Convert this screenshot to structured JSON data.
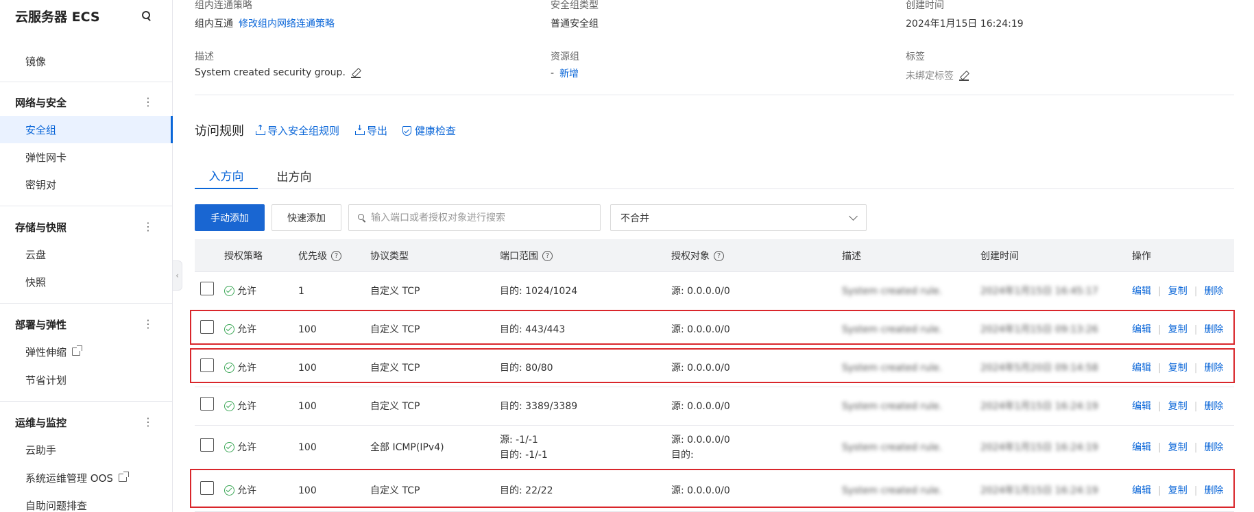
{
  "sidebar": {
    "title": "云服务器 ECS",
    "items_top": [
      "镜像"
    ],
    "groups": [
      {
        "title": "网络与安全",
        "items": [
          "安全组",
          "弹性网卡",
          "密钥对"
        ]
      },
      {
        "title": "存储与快照",
        "items": [
          "云盘",
          "快照"
        ]
      },
      {
        "title": "部署与弹性",
        "items": [
          "弹性伸缩",
          "节省计划"
        ]
      },
      {
        "title": "运维与监控",
        "items": [
          "云助手",
          "系统运维管理 OOS",
          "自助问题排查"
        ]
      }
    ],
    "collapse_glyph": "‹"
  },
  "info": {
    "intra_label": "组内连通策略",
    "intra_value": "组内互通",
    "intra_link": "修改组内网络连通策略",
    "type_label": "安全组类型",
    "type_value": "普通安全组",
    "created_label": "创建时间",
    "created_value": "2024年1月15日 16:24:19",
    "desc_label": "描述",
    "desc_value": "System created security group.",
    "rg_label": "资源组",
    "rg_dash": "-",
    "rg_link": "新增",
    "tags_label": "标签",
    "tags_value": "未绑定标签"
  },
  "rules": {
    "title": "访问规则",
    "import": "导入安全组规则",
    "export": "导出",
    "health": "健康检查"
  },
  "tabs": [
    "入方向",
    "出方向"
  ],
  "toolbar": {
    "manual_add": "手动添加",
    "quick_add": "快速添加",
    "search_placeholder": "输入端口或者授权对象进行搜索",
    "merge_select": "不合并"
  },
  "table": {
    "headers": [
      "授权策略",
      "优先级",
      "协议类型",
      "端口范围",
      "授权对象",
      "描述",
      "创建时间",
      "操作"
    ],
    "rows": [
      {
        "policy": "允许",
        "priority": "1",
        "protocol": "自定义 TCP",
        "port": [
          "目的: 1024/1024"
        ],
        "target": [
          "源: 0.0.0.0/0"
        ],
        "desc": "System created rule.",
        "created": "2024年1月15日 16:45:17",
        "highlight": false
      },
      {
        "policy": "允许",
        "priority": "100",
        "protocol": "自定义 TCP",
        "port": [
          "目的: 443/443"
        ],
        "target": [
          "源: 0.0.0.0/0"
        ],
        "desc": "System created rule.",
        "created": "2024年1月15日 09:13:26",
        "highlight": true
      },
      {
        "policy": "允许",
        "priority": "100",
        "protocol": "自定义 TCP",
        "port": [
          "目的: 80/80"
        ],
        "target": [
          "源: 0.0.0.0/0"
        ],
        "desc": "System created rule.",
        "created": "2024年5月20日 09:14:58",
        "highlight": true
      },
      {
        "policy": "允许",
        "priority": "100",
        "protocol": "自定义 TCP",
        "port": [
          "目的: 3389/3389"
        ],
        "target": [
          "源: 0.0.0.0/0"
        ],
        "desc": "System created rule.",
        "created": "2024年1月15日 16:24:19",
        "highlight": false
      },
      {
        "policy": "允许",
        "priority": "100",
        "protocol": "全部 ICMP(IPv4)",
        "port": [
          "源: -1/-1",
          "目的: -1/-1"
        ],
        "target": [
          "源: 0.0.0.0/0",
          "目的:"
        ],
        "desc": "System created rule.",
        "created": "2024年1月15日 16:24:19",
        "highlight": false
      },
      {
        "policy": "允许",
        "priority": "100",
        "protocol": "自定义 TCP",
        "port": [
          "目的: 22/22"
        ],
        "target": [
          "源: 0.0.0.0/0"
        ],
        "desc": "System created rule.",
        "created": "2024年1月15日 16:24:19",
        "highlight": true
      }
    ],
    "ops": [
      "编辑",
      "复制",
      "删除"
    ]
  },
  "colors": {
    "accent": "#0a66d8",
    "highlight": "#d9262b",
    "ok": "#3aa655"
  }
}
